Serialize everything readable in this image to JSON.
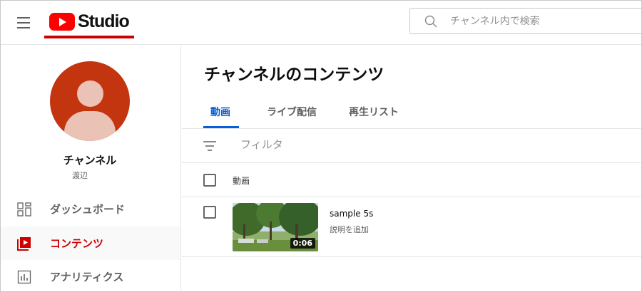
{
  "header": {
    "logo_text": "Studio",
    "search_placeholder": "チャンネル内で検索"
  },
  "channel": {
    "name": "チャンネル",
    "subtitle": "渡辺"
  },
  "sidebar": {
    "items": [
      {
        "label": "ダッシュボード",
        "icon": "dashboard-icon",
        "active": false
      },
      {
        "label": "コンテンツ",
        "icon": "content-icon",
        "active": true
      },
      {
        "label": "アナリティクス",
        "icon": "analytics-icon",
        "active": false
      }
    ]
  },
  "main": {
    "title": "チャンネルのコンテンツ",
    "tabs": [
      {
        "label": "動画",
        "active": true
      },
      {
        "label": "ライブ配信",
        "active": false
      },
      {
        "label": "再生リスト",
        "active": false
      }
    ],
    "filter_placeholder": "フィルタ",
    "column_header": "動画",
    "videos": [
      {
        "title": "sample 5s",
        "description": "説明を追加",
        "duration": "0:06"
      }
    ]
  },
  "colors": {
    "brand_red": "#ff0000",
    "active_red": "#cc0000",
    "active_blue": "#065fd4",
    "avatar_bg": "#c2350f"
  }
}
